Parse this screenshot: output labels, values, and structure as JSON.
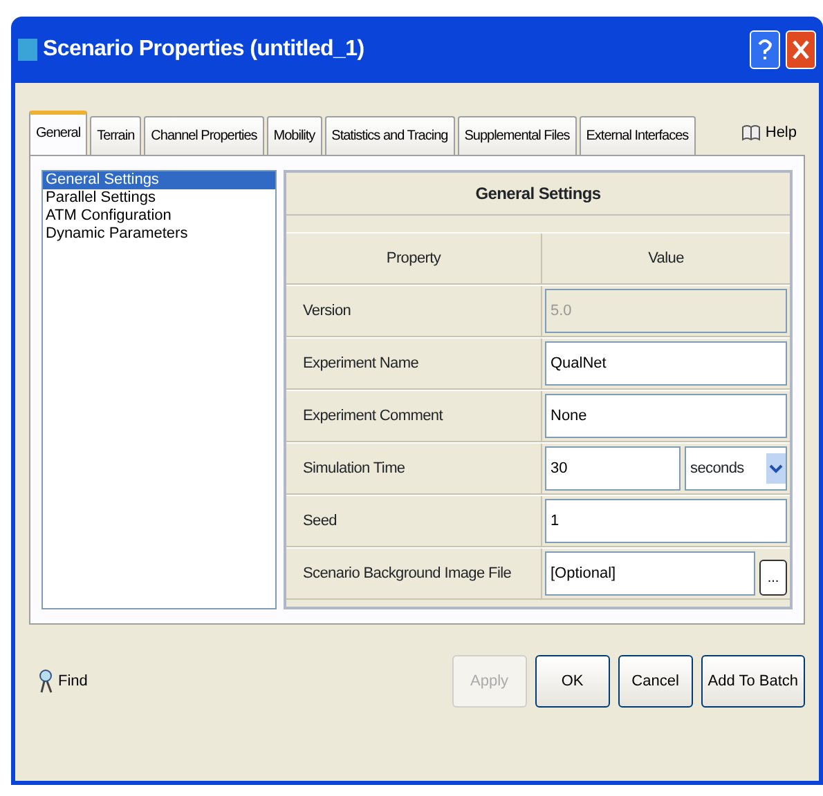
{
  "window": {
    "title": "Scenario Properties (untitled_1)"
  },
  "tabs": [
    {
      "label": "General",
      "selected": true
    },
    {
      "label": "Terrain",
      "selected": false
    },
    {
      "label": "Channel Properties",
      "selected": false
    },
    {
      "label": "Mobility",
      "selected": false
    },
    {
      "label": "Statistics and Tracing",
      "selected": false
    },
    {
      "label": "Supplemental Files",
      "selected": false
    },
    {
      "label": "External Interfaces",
      "selected": false
    }
  ],
  "help": "Help",
  "sidebar": {
    "items": [
      {
        "label": "General Settings",
        "selected": true
      },
      {
        "label": "Parallel Settings",
        "selected": false
      },
      {
        "label": "ATM Configuration",
        "selected": false
      },
      {
        "label": "Dynamic Parameters",
        "selected": false
      }
    ]
  },
  "table": {
    "title": "General Settings",
    "columns": [
      "Property",
      "Value"
    ],
    "rows": [
      {
        "kind": "text",
        "property": "Version",
        "value": "5.0",
        "disabled": true
      },
      {
        "kind": "text",
        "property": "Experiment Name",
        "value": "QualNet",
        "disabled": false
      },
      {
        "kind": "text",
        "property": "Experiment Comment",
        "value": "None",
        "disabled": false
      },
      {
        "kind": "select",
        "property": "Simulation Time",
        "value": "30",
        "unit": "seconds",
        "disabled": false
      },
      {
        "kind": "text",
        "property": "Seed",
        "value": "1",
        "disabled": false
      },
      {
        "kind": "file",
        "property": "Scenario Background Image File",
        "value": "[Optional]",
        "browse": "...",
        "disabled": false
      }
    ]
  },
  "find": "Find",
  "buttons": [
    {
      "label": "Apply",
      "disabled": true
    },
    {
      "label": "OK",
      "disabled": false
    },
    {
      "label": "Cancel",
      "disabled": false
    },
    {
      "label": "Add To Batch",
      "disabled": false
    }
  ]
}
